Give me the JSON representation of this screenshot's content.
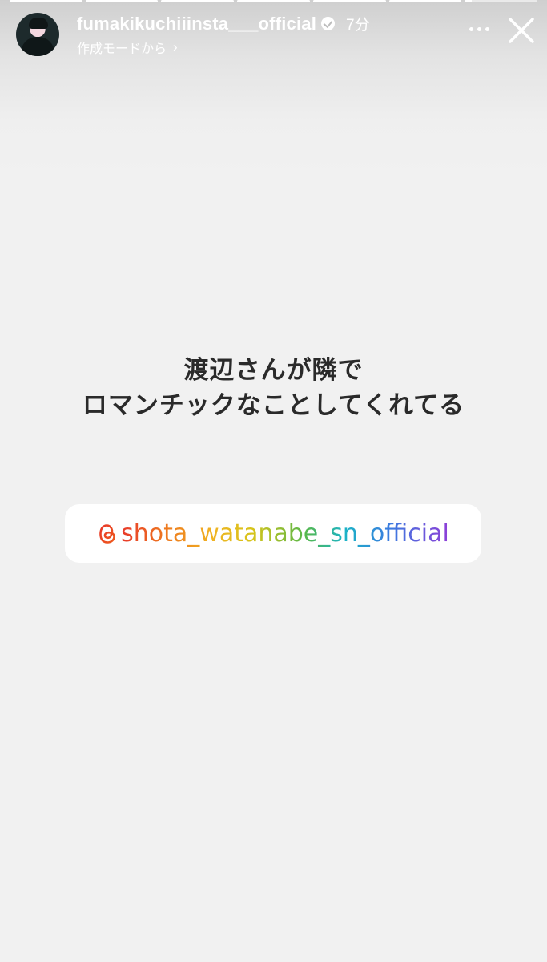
{
  "story": {
    "progress_segments": [
      {
        "fill": 1
      },
      {
        "fill": 1
      },
      {
        "fill": 1
      },
      {
        "fill": 1
      },
      {
        "fill": 1
      },
      {
        "fill": 1
      },
      {
        "fill": 0.1
      }
    ]
  },
  "header": {
    "username": "fumakikuchiiinsta___official",
    "time": "7分",
    "subline": "作成モードから",
    "subline_chevron": "›",
    "icons": {
      "avatar": "profile-avatar",
      "verified": "verified-badge-icon",
      "more": "more-options-icon",
      "close": "close-icon",
      "chevron": "chevron-right-icon"
    }
  },
  "caption": {
    "line1": "渡辺さんが隣で",
    "line2": "ロマンチックなことしてくれてる"
  },
  "mention": {
    "icon": "threads-icon",
    "handle": "shota_watanabe_sn_official"
  },
  "colors": {
    "background": "#f1f1f1",
    "caption": "#2a2a2a",
    "sticker_bg": "#ffffff",
    "gradient": [
      "#e8382a",
      "#ee7a1e",
      "#f0b323",
      "#d7c41a",
      "#57b84a",
      "#1bb4c6",
      "#3b7be0",
      "#8e3fd8"
    ]
  }
}
